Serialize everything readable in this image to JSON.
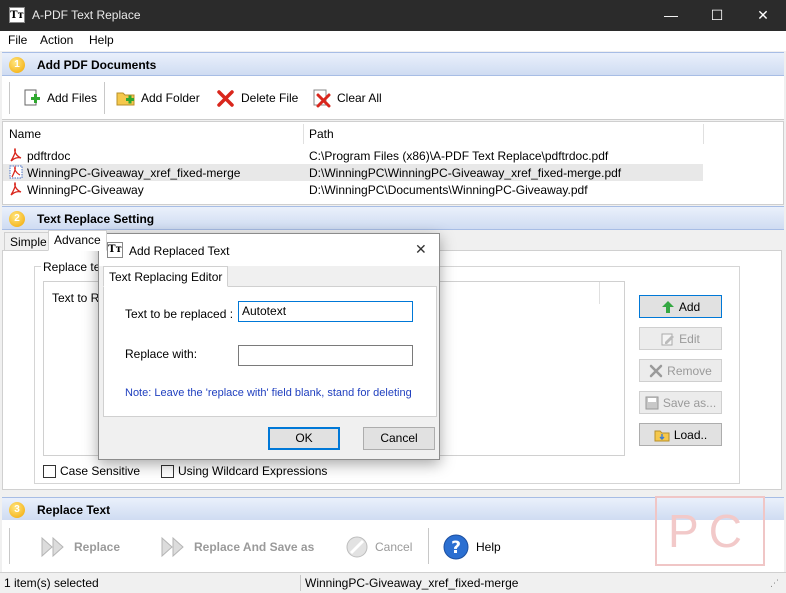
{
  "window": {
    "title": "A-PDF Text Replace",
    "icon_text": "Tт",
    "minimize": "—",
    "maximize": "☐",
    "close": "✕"
  },
  "menu": [
    "File",
    "Action",
    "Help"
  ],
  "sections": {
    "add": {
      "num": "1",
      "label": "Add PDF Documents"
    },
    "setting": {
      "num": "2",
      "label": "Text Replace Setting"
    },
    "replace": {
      "num": "3",
      "label": "Replace Text"
    }
  },
  "toolbar": {
    "add_files": "Add Files",
    "add_folder": "Add Folder",
    "delete_file": "Delete File",
    "clear_all": "Clear All"
  },
  "file_list": {
    "columns": [
      "Name",
      "Path"
    ],
    "rows": [
      {
        "name": "pdftrdoc",
        "path": "C:\\Program Files (x86)\\A-PDF Text Replace\\pdftrdoc.pdf"
      },
      {
        "name": "WinningPC-Giveaway_xref_fixed-merge",
        "path": "D:\\WinningPC\\WinningPC-Giveaway_xref_fixed-merge.pdf"
      },
      {
        "name": "WinningPC-Giveaway",
        "path": "D:\\WinningPC\\Documents\\WinningPC-Giveaway.pdf"
      }
    ]
  },
  "tabs": [
    "Simple",
    "Advance"
  ],
  "replace_group": {
    "label": "Replace tex",
    "list_header": "Text to Re"
  },
  "side_buttons": {
    "add": "Add",
    "edit": "Edit",
    "remove": "Remove",
    "save_as": "Save as...",
    "load": "Load.."
  },
  "options": {
    "case_sensitive": "Case Sensitive",
    "wildcard": "Using Wildcard Expressions"
  },
  "bottom_toolbar": {
    "replace": "Replace",
    "replace_save": "Replace And Save as",
    "cancel": "Cancel",
    "help": "Help"
  },
  "status": {
    "selected": "1 item(s) selected",
    "current": "WinningPC-Giveaway_xref_fixed-merge"
  },
  "dialog": {
    "title": "Add Replaced Text",
    "close": "✕",
    "tab": "Text Replacing Editor",
    "text_label": "Text to be replaced :",
    "text_value": "Autotext",
    "replace_label": "Replace with:",
    "replace_value": "",
    "note": "Note: Leave the 'replace with' field blank, stand for deleting",
    "ok": "OK",
    "cancel": "Cancel"
  },
  "watermark": "PC",
  "colors": {
    "accent": "#0078d7",
    "note": "#1f3fbf",
    "section_bg": "#d6e2f5"
  }
}
